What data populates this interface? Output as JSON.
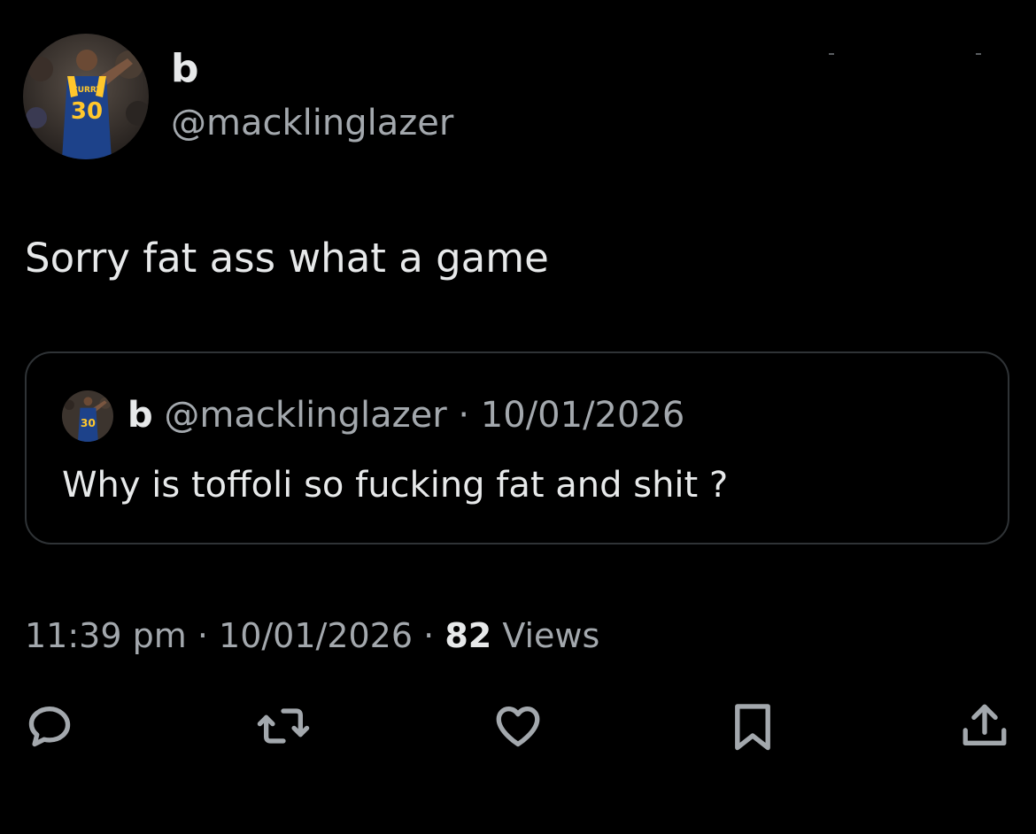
{
  "author": {
    "display_name": "b",
    "handle": "@macklinglazer",
    "avatar_icon": "basketball-player-avatar",
    "jersey_name": "CURRY",
    "jersey_number": "30"
  },
  "tweet": {
    "text": "Sorry fat ass what a game"
  },
  "quoted_tweet": {
    "display_name": "b",
    "handle": "@macklinglazer",
    "separator": "·",
    "date": "10/01/2026",
    "text": "Why is toffoli so fucking fat and shit ?"
  },
  "meta": {
    "time": "11:39 pm",
    "separator": "·",
    "date": "10/01/2026",
    "views_count": "82",
    "views_label": "Views"
  },
  "actions": [
    {
      "icon": "reply-icon"
    },
    {
      "icon": "retweet-icon"
    },
    {
      "icon": "like-icon"
    },
    {
      "icon": "bookmark-icon"
    },
    {
      "icon": "share-icon"
    }
  ],
  "colors": {
    "background": "#000000",
    "primary_text": "#e7e9ea",
    "secondary_text": "#a3a8ad",
    "border": "#2f3336",
    "jersey_blue": "#1d428a",
    "jersey_gold": "#ffc72c"
  }
}
